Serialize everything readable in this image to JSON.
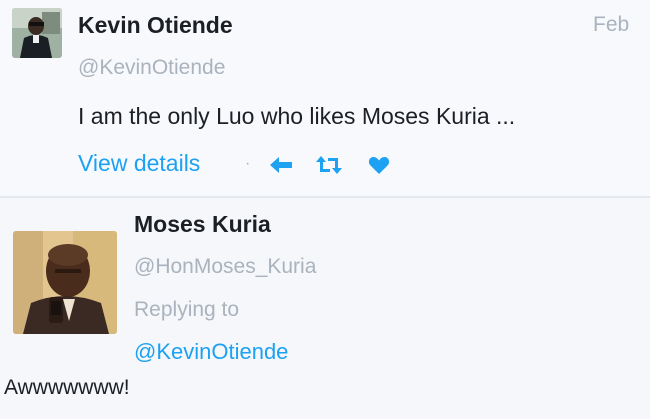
{
  "tweet1": {
    "author_name": "Kevin Otiende",
    "handle": "@KevinOtiende",
    "date": "Feb",
    "text": "I am the only Luo who likes Moses Kuria ...",
    "view_details": "View details",
    "separator": "·",
    "actions": [
      "reply-icon",
      "retweet-icon",
      "like-icon"
    ]
  },
  "tweet2": {
    "author_name": "Moses Kuria",
    "handle": "@HonMoses_Kuria",
    "replying_to_label": "Replying to",
    "replying_to_handle": "@KevinOtiende",
    "text": "Awwwwwww!"
  },
  "colors": {
    "link": "#1da1f2",
    "muted": "#aab3bd",
    "text": "#1c1f23",
    "background": "#f6f8fc"
  }
}
